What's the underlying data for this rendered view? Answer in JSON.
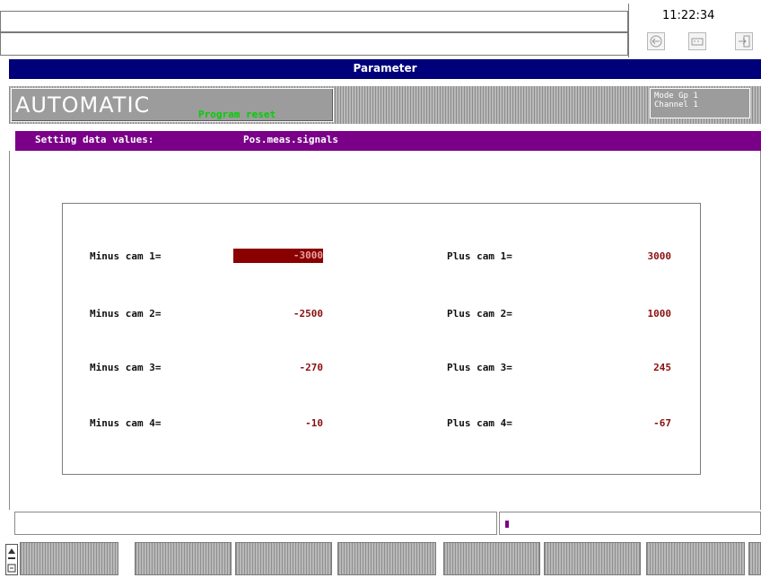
{
  "header": {
    "time": "11:22:34",
    "title": "Parameter"
  },
  "status": {
    "mode": "AUTOMATIC",
    "program_state": "Program reset",
    "mode_group_label": "Mode Gp 1",
    "channel_label": "Channel 1"
  },
  "section": {
    "heading": "Setting data values:",
    "subheading": "Pos.meas.signals"
  },
  "params": {
    "minus": [
      {
        "label": "Minus cam 1=",
        "value": "-3000",
        "selected": true
      },
      {
        "label": "Minus cam 2=",
        "value": "-2500"
      },
      {
        "label": "Minus cam 3=",
        "value": "-270"
      },
      {
        "label": "Minus cam 4=",
        "value": "-10"
      }
    ],
    "plus": [
      {
        "label": "Plus cam 1=",
        "value": "3000"
      },
      {
        "label": "Plus cam 2=",
        "value": "1000"
      },
      {
        "label": "Plus cam 3=",
        "value": "245"
      },
      {
        "label": "Plus cam 4=",
        "value": "-67"
      }
    ]
  },
  "icons": [
    "back-icon",
    "keyboard-icon",
    "exit-icon",
    "recall-icon"
  ],
  "colors": {
    "title_bar": "#00007a",
    "heading_bar": "#7a0088",
    "value_text": "#8a1010",
    "selected_value_bg": "#8a0000",
    "program_state": "#00d000"
  }
}
